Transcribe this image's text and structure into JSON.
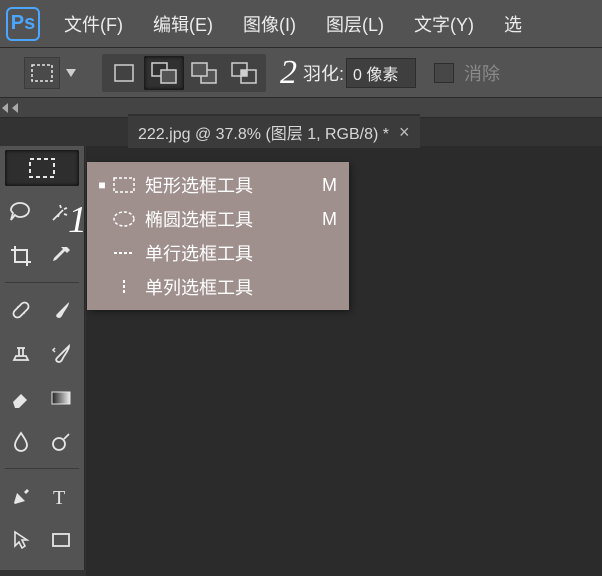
{
  "menubar": {
    "logo": "Ps",
    "items": [
      "文件(F)",
      "编辑(E)",
      "图像(I)",
      "图层(L)",
      "文字(Y)",
      "选"
    ]
  },
  "optionsbar": {
    "annotation2": "2",
    "feather_label": "羽化:",
    "feather_value": "0 像素",
    "antialias_label": "消除"
  },
  "tab": {
    "title": "222.jpg @ 37.8% (图层 1, RGB/8) *",
    "close": "×"
  },
  "flyout": {
    "items": [
      {
        "label": "矩形选框工具",
        "shortcut": "M",
        "selected": true
      },
      {
        "label": "椭圆选框工具",
        "shortcut": "M",
        "selected": false
      },
      {
        "label": "单行选框工具",
        "shortcut": "",
        "selected": false
      },
      {
        "label": "单列选框工具",
        "shortcut": "",
        "selected": false
      }
    ]
  },
  "annotation1": "1"
}
